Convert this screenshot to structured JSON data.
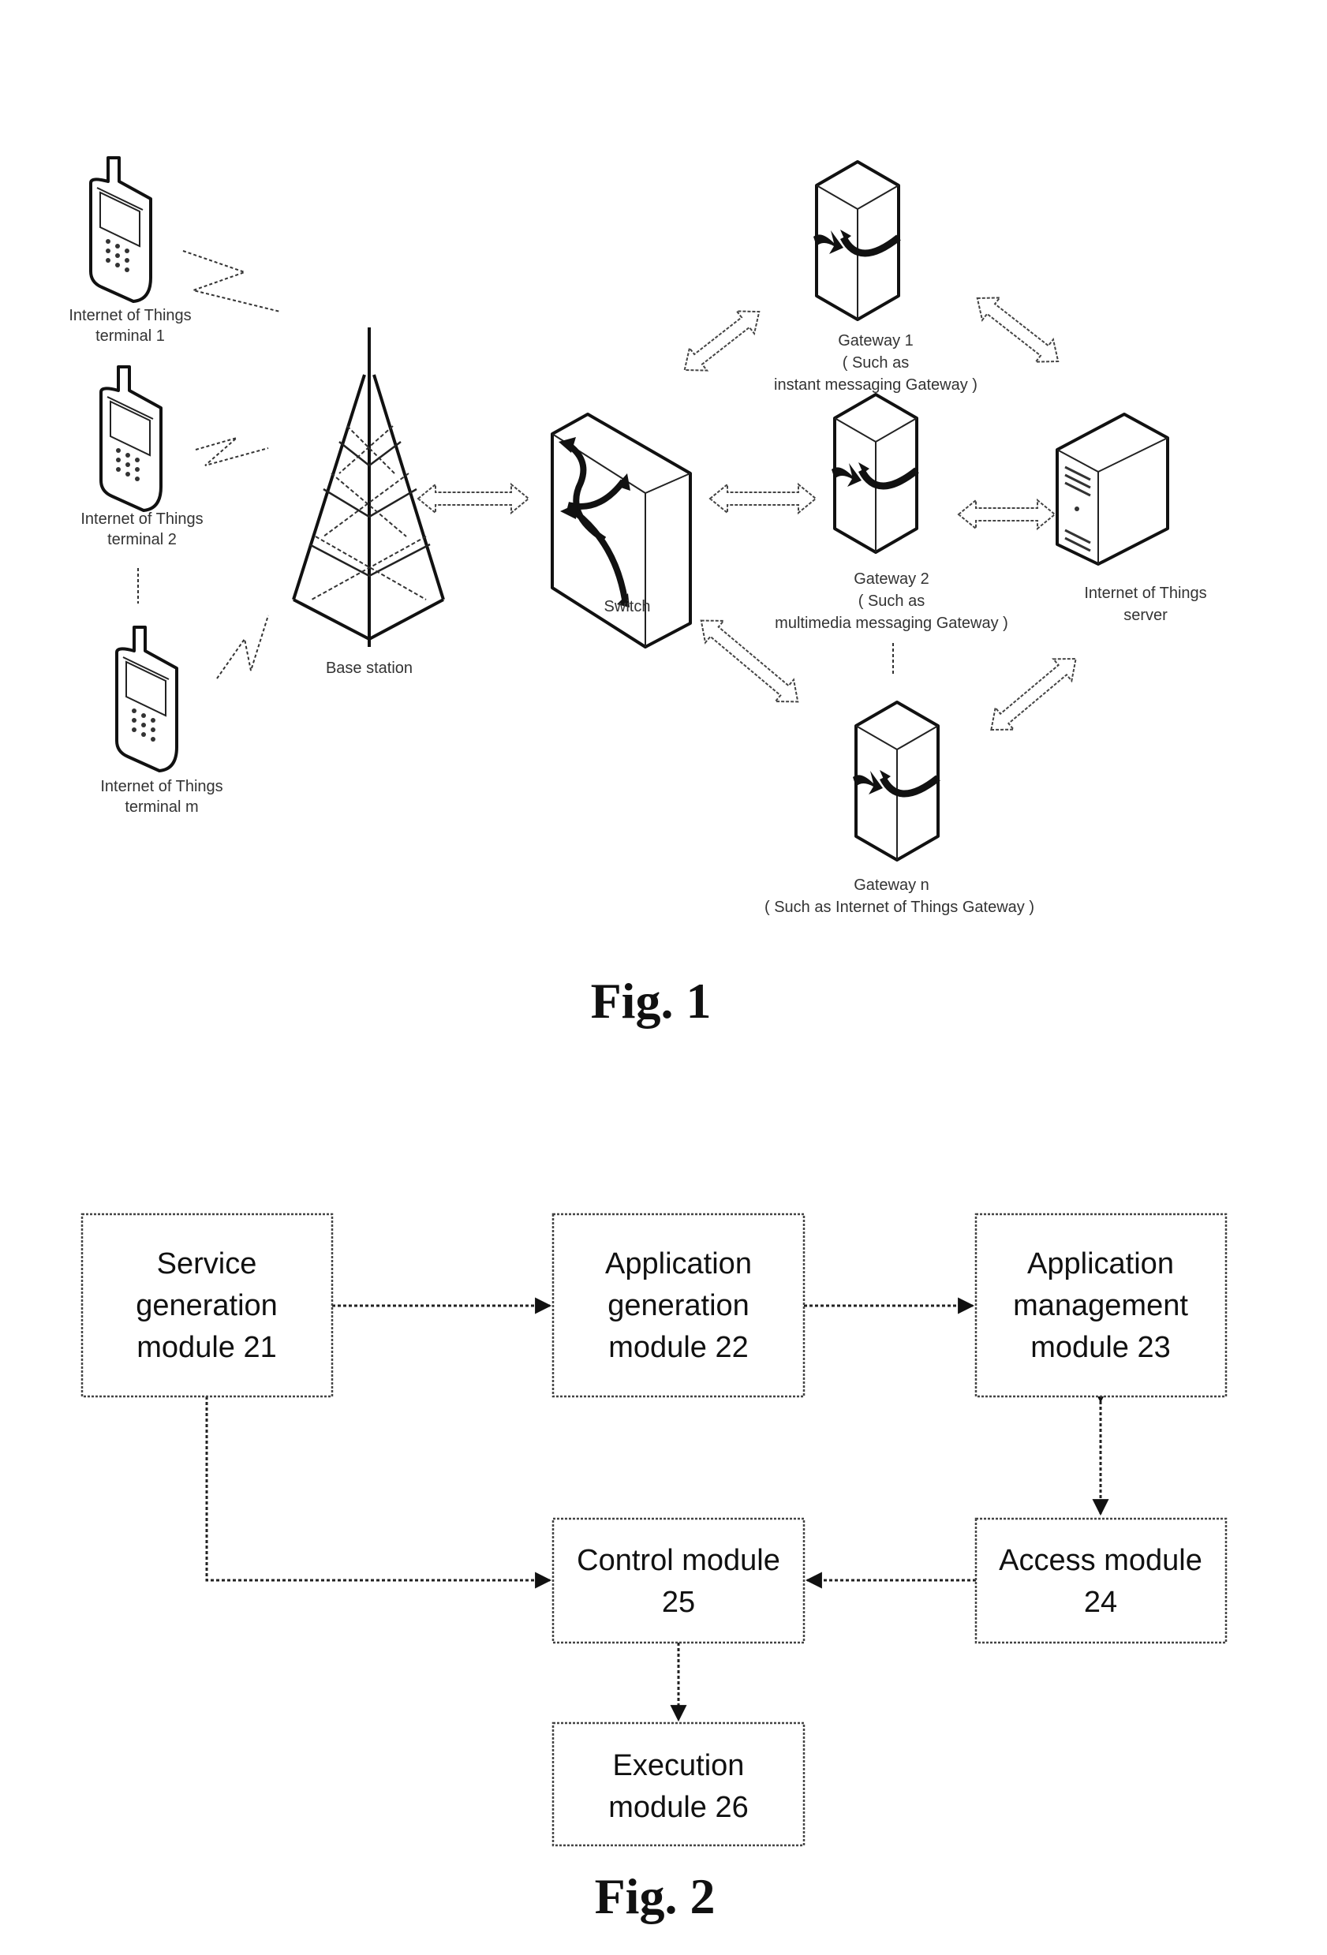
{
  "fig1": {
    "caption": "Fig. 1",
    "terminals": [
      {
        "line1": "Internet of Things",
        "line2": "terminal 1"
      },
      {
        "line1": "Internet of Things",
        "line2": "terminal 2"
      },
      {
        "line1": "Internet of Things",
        "line2": "terminal m"
      }
    ],
    "base_station": "Base station",
    "switch": "Switch",
    "gateways": [
      {
        "line1": "Gateway 1",
        "line2": "( Such as",
        "line3": "instant messaging Gateway )"
      },
      {
        "line1": "Gateway 2",
        "line2": "( Such as",
        "line3": "multimedia messaging Gateway )"
      },
      {
        "line1": "Gateway n",
        "line2": "( Such as Internet of Things Gateway )"
      }
    ],
    "server": {
      "line1": "Internet of Things",
      "line2": "server"
    }
  },
  "fig2": {
    "caption": "Fig. 2",
    "modules": {
      "m21": [
        "Service",
        "generation",
        "module 21"
      ],
      "m22": [
        "Application",
        "generation",
        "module 22"
      ],
      "m23": [
        "Application",
        "management",
        "module 23"
      ],
      "m24": [
        "Access module",
        "24"
      ],
      "m25": [
        "Control module",
        "25"
      ],
      "m26": [
        "Execution",
        "module 26"
      ]
    }
  }
}
